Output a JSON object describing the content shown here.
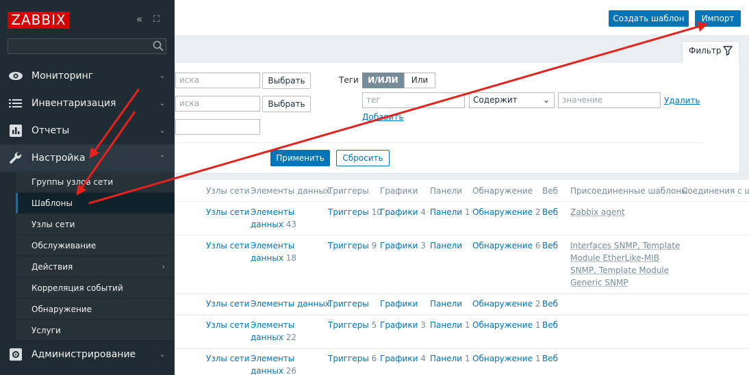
{
  "brand": {
    "logo": "ZABBIX"
  },
  "sidebar": {
    "collapse_icon": "«",
    "expand_icon": "⛶",
    "search_placeholder": "",
    "sections": [
      {
        "label": "Мониторинг",
        "icon": "eye-icon",
        "chevron": "⌄"
      },
      {
        "label": "Инвентаризация",
        "icon": "list-icon",
        "chevron": "⌄"
      },
      {
        "label": "Отчеты",
        "icon": "bar-chart-icon",
        "chevron": "⌄"
      },
      {
        "label": "Настройка",
        "icon": "wrench-icon",
        "chevron": "⌃"
      },
      {
        "label": "Администрирование",
        "icon": "gear-icon",
        "chevron": "⌄"
      }
    ],
    "config_items": [
      {
        "label": "Группы узлов сети"
      },
      {
        "label": "Шаблоны",
        "active": true
      },
      {
        "label": "Узлы сети"
      },
      {
        "label": "Обслуживание"
      },
      {
        "label": "Действия",
        "chevron": "›"
      },
      {
        "label": "Корреляция событий"
      },
      {
        "label": "Обнаружение"
      },
      {
        "label": "Услуги"
      }
    ]
  },
  "header": {
    "create_template": "Создать шаблон",
    "import": "Импорт"
  },
  "filter": {
    "tab_label": "Фильтр",
    "name_placeholder_1": "иска",
    "name_placeholder_2": "иска",
    "select_label_1": "Выбрать",
    "select_label_2": "Выбрать",
    "tags_label": "Теги",
    "and_or": "И/ИЛИ",
    "or": "Или",
    "tag_placeholder": "тег",
    "operator": "Содержит",
    "value_placeholder": "значение",
    "remove": "Удалить",
    "add": "Добавить",
    "apply": "Применить",
    "reset": "Сбросить"
  },
  "table": {
    "columns": [
      "Узлы сети",
      "Элементы данных",
      "Триггеры",
      "Графики",
      "Панели",
      "Обнаружение",
      "Веб",
      "Присоединенные шаблоны",
      "Соединения с ша"
    ],
    "rows": [
      {
        "hosts": "Узлы сети",
        "items_a": "Элементы",
        "items_b": "данных",
        "items_count": "43",
        "triggers": "Триггеры",
        "triggers_count": "10",
        "graphs": "Графики",
        "graphs_count": "4",
        "dashboards": "Панели",
        "dashboards_count": "1",
        "discovery": "Обнаружение",
        "discovery_count": "2",
        "web": "Веб",
        "linked": [
          "Zabbix agent"
        ]
      },
      {
        "hosts": "Узлы сети",
        "items_a": "Элементы",
        "items_b": "данных",
        "items_count": "18",
        "triggers": "Триггеры",
        "triggers_count": "9",
        "graphs": "Графики",
        "graphs_count": "3",
        "dashboards": "Панели",
        "dashboards_count": "",
        "discovery": "Обнаружение",
        "discovery_count": "6",
        "web": "Веб",
        "linked": [
          "Interfaces SNMP, Template",
          "Module EtherLike-MIB",
          "SNMP, Template Module",
          "Generic SNMP"
        ]
      },
      {
        "hosts": "Узлы сети",
        "items_a": "Элементы данных",
        "items_b": "",
        "items_count": "",
        "triggers": "Триггеры",
        "triggers_count": "",
        "graphs": "Графики",
        "graphs_count": "",
        "dashboards": "Панели",
        "dashboards_count": "",
        "discovery": "Обнаружение",
        "discovery_count": "2",
        "web": "Веб",
        "linked": []
      },
      {
        "hosts": "Узлы сети",
        "items_a": "Элементы",
        "items_b": "данных",
        "items_count": "22",
        "triggers": "Триггеры",
        "triggers_count": "5",
        "graphs": "Графики",
        "graphs_count": "3",
        "dashboards": "Панели",
        "dashboards_count": "1",
        "discovery": "Обнаружение",
        "discovery_count": "1",
        "web": "Веб",
        "linked": []
      },
      {
        "hosts": "Узлы сети",
        "items_a": "Элементы",
        "items_b": "данных",
        "items_count": "26",
        "triggers": "Триггеры",
        "triggers_count": "6",
        "graphs": "Графики",
        "graphs_count": "4",
        "dashboards": "Панели",
        "dashboards_count": "1",
        "discovery": "Обнаружение",
        "discovery_count": "1",
        "web": "Веб",
        "linked": []
      }
    ]
  },
  "colors": {
    "sidebar_bg": "#1f2c33",
    "accent": "#0275b8",
    "logo_red": "#d40000",
    "annotation_arrow": "#e8211d"
  }
}
